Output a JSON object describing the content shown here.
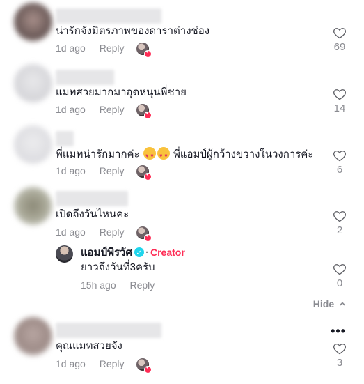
{
  "comments": [
    {
      "text": "น่ารักจังมิตรภาพของดาราต่างช่อง",
      "time": "1d ago",
      "reply": "Reply",
      "likes": "69"
    },
    {
      "text": "แมทสวยมากมาอุดหนุนพี่ชาย",
      "time": "1d ago",
      "reply": "Reply",
      "likes": "14"
    },
    {
      "text_a": "พี่แมทน่ารักมากค่ะ",
      "text_b": "พี่แอมป์ผู้กว้างขวางในวงการค่ะ",
      "time": "1d ago",
      "reply": "Reply",
      "likes": "6"
    },
    {
      "text": "เปิดถึงวันไหนค่ะ",
      "time": "1d ago",
      "reply": "Reply",
      "likes": "2"
    },
    {
      "text": "คุณแมทสวยจัง",
      "time": "1d ago",
      "reply": "Reply",
      "likes": "3"
    }
  ],
  "creator_reply": {
    "name": "แอมป์พีรวัศ",
    "separator": "·",
    "badge": "Creator",
    "text": "ยาวถึงวันที่3ครับ",
    "time": "15h ago",
    "reply": "Reply",
    "likes": "0"
  },
  "hide_label": "Hide",
  "more_label": "•••",
  "colors": {
    "accent": "#fe2c55",
    "verified": "#20d5ec",
    "muted": "#8a8b91"
  }
}
